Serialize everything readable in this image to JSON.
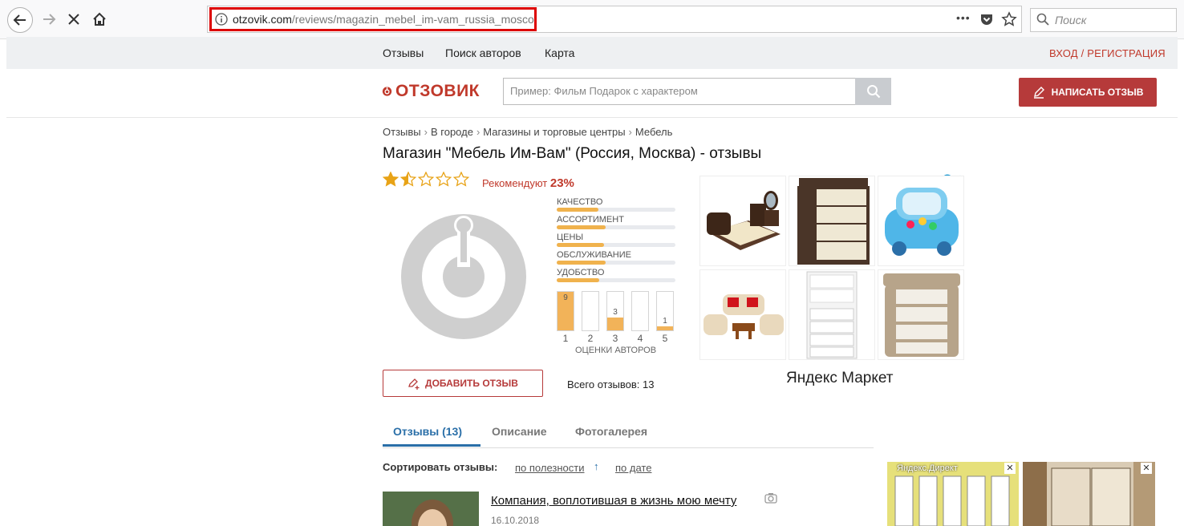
{
  "browser": {
    "url_domain": "otzovik.com",
    "url_path": "/reviews/magazin_mebel_im-vam_russia_moscow",
    "search_placeholder": "Поиск",
    "menu_dots": "•••"
  },
  "sitenav": {
    "links": [
      "Отзывы",
      "Поиск авторов",
      "Карта"
    ],
    "login": "ВХОД / РЕГИСТРАЦИЯ"
  },
  "header": {
    "logo_text": "ОТЗОВИК",
    "search_placeholder": "Пример: Фильм Подарок с характером",
    "write_review": "НАПИСАТЬ ОТЗЫВ"
  },
  "breadcrumbs": [
    "Отзывы",
    "В городе",
    "Магазины и торговые центры",
    "Мебель"
  ],
  "page_title": "Магазин \"Мебель Им-Вам\" (Россия, Москва) - отзывы",
  "rating": {
    "stars": 1.5,
    "recommend_label": "Рекомендуют",
    "recommend_value": "23%",
    "criteria": [
      {
        "label": "КАЧЕСТВО",
        "fraction": 0.35
      },
      {
        "label": "АССОРТИМЕНТ",
        "fraction": 0.41
      },
      {
        "label": "ЦЕНЫ",
        "fraction": 0.4
      },
      {
        "label": "ОБСЛУЖИВАНИЕ",
        "fraction": 0.41
      },
      {
        "label": "УДОБСТВО",
        "fraction": 0.36
      }
    ],
    "histogram": [
      {
        "score": "1",
        "count": "9",
        "fraction": 1.0
      },
      {
        "score": "2",
        "count": "",
        "fraction": 0
      },
      {
        "score": "3",
        "count": "3",
        "fraction": 0.34
      },
      {
        "score": "4",
        "count": "",
        "fraction": 0
      },
      {
        "score": "5",
        "count": "1",
        "fraction": 0.11
      }
    ],
    "histogram_caption": "ОЦЕНКИ АВТОРОВ"
  },
  "actions": {
    "add_review": "ДОБАВИТЬ ОТЗЫВ",
    "total_label": "Всего отзывов: 13"
  },
  "ads": {
    "market_label": "Яндекс Маркет",
    "direct_label": "Яндекс.Директ"
  },
  "tabs": [
    "Отзывы (13)",
    "Описание",
    "Фотогалерея"
  ],
  "sort": {
    "label": "Сортировать отзывы:",
    "by_useful": "по полезности",
    "by_date": "по дате",
    "arrow": "↑"
  },
  "review": {
    "title": "Компания, воплотившая в жизнь мою мечту",
    "date": "16.10.2018"
  },
  "colors": {
    "brand": "#c0392b",
    "accent_tab": "#2a6fa8",
    "star": "#e8a317",
    "bar_fill": "#f0b24d"
  }
}
